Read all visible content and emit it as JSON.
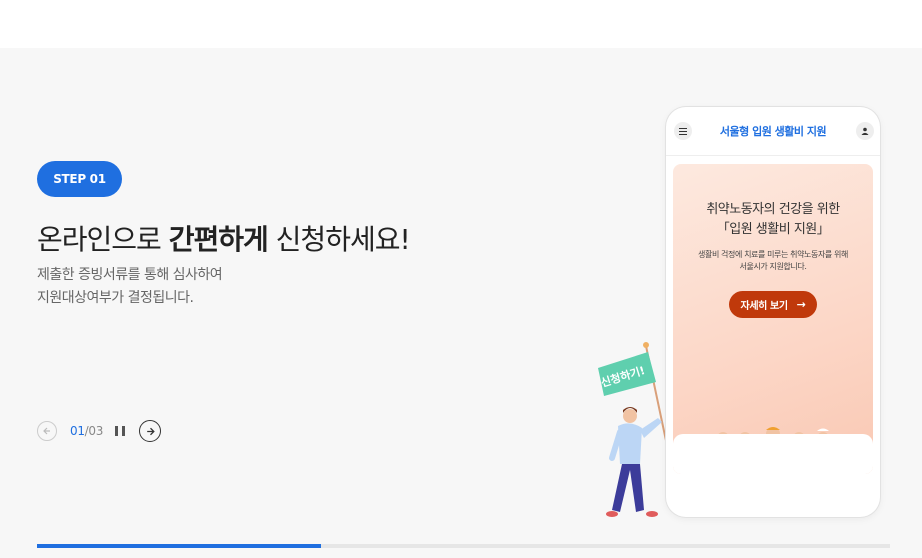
{
  "slide": {
    "step": "STEP 01",
    "headline_pre": "온라인으로",
    "headline_bold": "간편하게",
    "headline_post": "신청하세요!",
    "desc_line1": "제출한 증빙서류를 통해 심사하여",
    "desc_line2": "지원대상여부가 결정됩니다."
  },
  "pager": {
    "current": "01",
    "separator": "/",
    "total": "03",
    "progress": 0.333
  },
  "phone": {
    "title": "서울형 입원 생활비 지원",
    "banner_title_1": "취약노동자의 건강을 위한",
    "banner_title_2": "「입원 생활비 지원」",
    "banner_text_1": "생활비 걱정에 치료를 미루는 취약노동자를 위해",
    "banner_text_2": "서울시가 지원합니다.",
    "button": "자세히 보기"
  },
  "illustration": {
    "flag_text": "신청하기!"
  },
  "colors": {
    "accent": "#1f6fe0",
    "banner_button": "#c0390b",
    "flag": "#5fcfae"
  }
}
